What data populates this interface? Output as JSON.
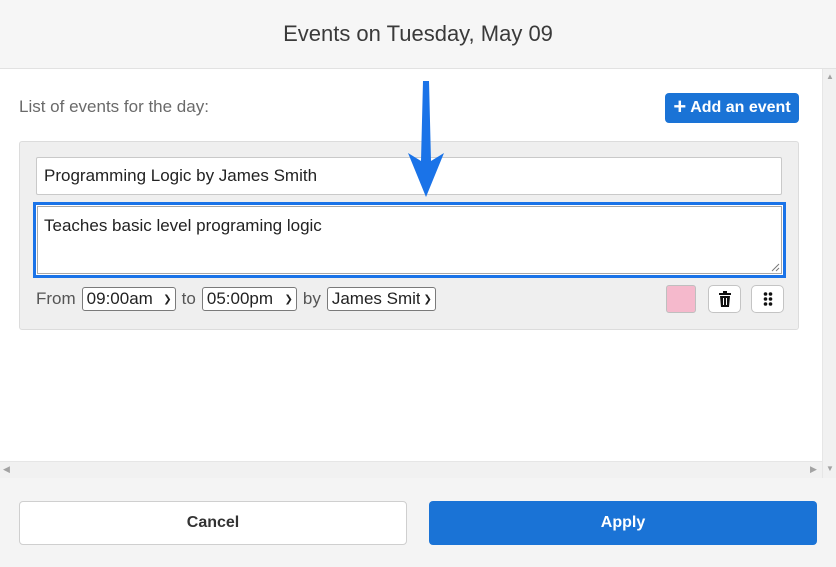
{
  "dialog": {
    "title": "Events on Tuesday, May 09"
  },
  "list": {
    "label": "List of events for the day:",
    "add_button": {
      "icon": "plus-icon",
      "label": "Add an event"
    }
  },
  "event": {
    "title_value": "Programming Logic by James Smith",
    "description_value": "Teaches basic level programing logic",
    "from_label": "From",
    "from_time": "09:00am",
    "to_label": "to",
    "to_time": "05:00pm",
    "by_label": "by",
    "owner": "James Smith",
    "color": "#f5b9cc",
    "delete_icon": "trash-icon",
    "drag_icon": "drag-handle-icon"
  },
  "annotation": {
    "icon": "arrow-down-icon",
    "color": "#1a73e8"
  },
  "footer": {
    "cancel_label": "Cancel",
    "apply_label": "Apply"
  },
  "colors": {
    "accent": "#1a73d6",
    "focus": "#1a73e8"
  }
}
